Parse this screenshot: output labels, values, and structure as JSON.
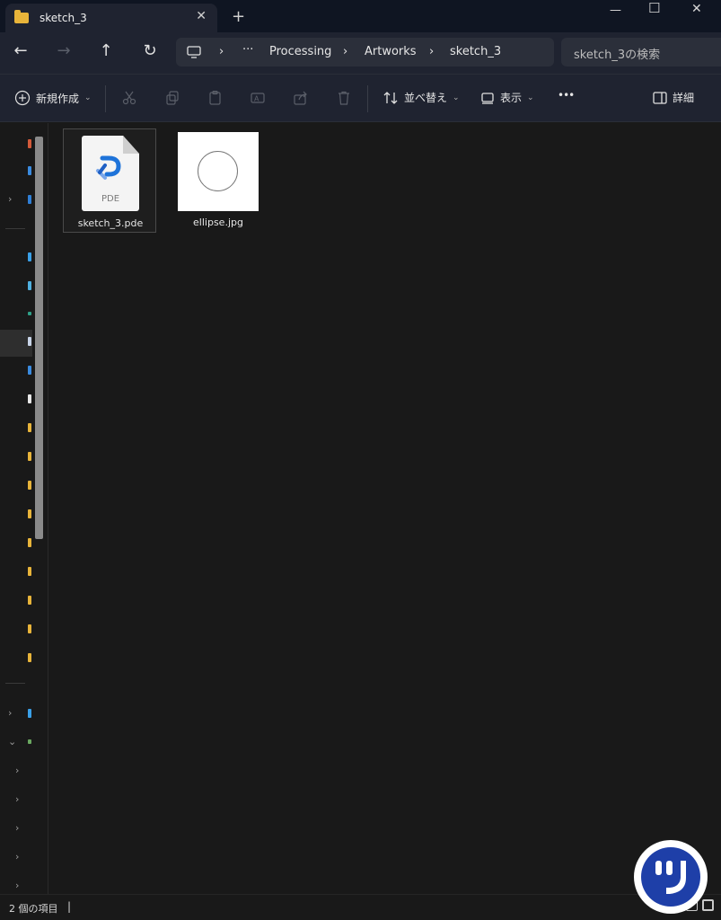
{
  "tab": {
    "title": "sketch_3",
    "close_glyph": "✕",
    "new_tab_glyph": "+"
  },
  "window_controls": {
    "minimize": "—",
    "maximize": "☐",
    "close": "✕"
  },
  "nav": {
    "back": "←",
    "forward": "→",
    "up": "↑",
    "refresh": "↻",
    "breadcrumb": {
      "pc_icon": "monitor-icon",
      "separator": "›",
      "more": "···",
      "items": [
        "Processing",
        "Artworks",
        "sketch_3"
      ]
    },
    "search_placeholder": "sketch_3の検索"
  },
  "commands": {
    "new_label": "新規作成",
    "sort_label": "並べ替え",
    "view_label": "表示",
    "more_label": "•••",
    "details_label": "詳細",
    "chevron": "⌄"
  },
  "files": [
    {
      "name": "sketch_3.pde",
      "type_label": "PDE",
      "icon": "processing-file-icon",
      "selected": true
    },
    {
      "name": "ellipse.jpg",
      "icon": "image-thumbnail"
    }
  ],
  "status": {
    "count_text": "2 個の項目",
    "caret": "|"
  },
  "colors": {
    "accent": "#1e73d9",
    "folder": "#e8b43a",
    "background": "#191919",
    "chrome": "#1f2330"
  }
}
